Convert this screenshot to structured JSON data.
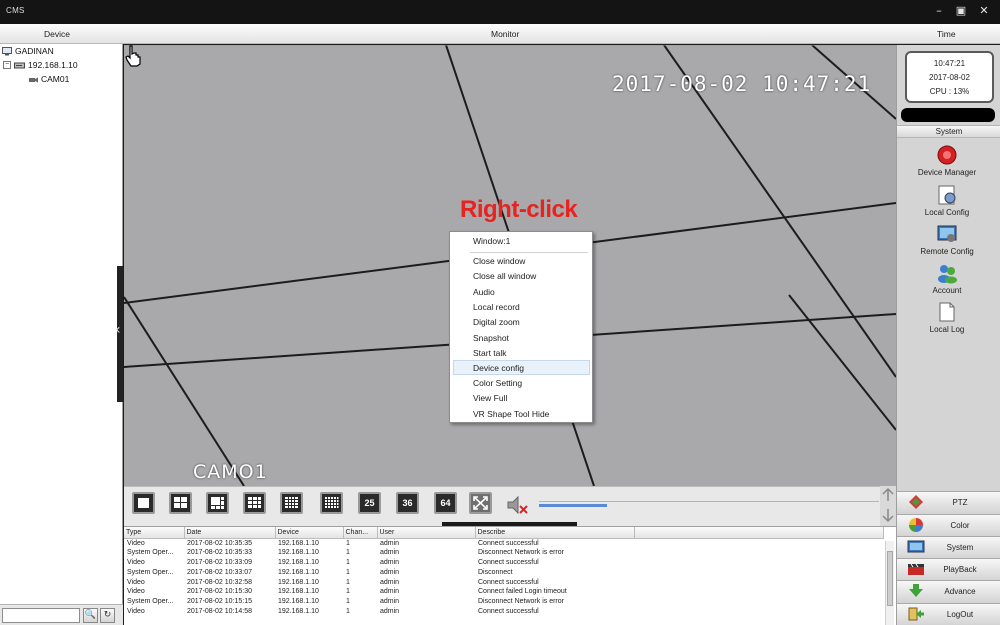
{
  "window": {
    "title": "CMS",
    "minimize": "–",
    "restore": "▣",
    "close": "✕"
  },
  "header": {
    "device": "Device",
    "monitor": "Monitor",
    "time": "Time"
  },
  "tree": {
    "root": "GADINAN",
    "device": "192.168.1.10",
    "channel": "CAM01",
    "expand_symbol": "−"
  },
  "search": {
    "value": "",
    "search_icon": "magnifier-icon",
    "refresh_icon": "refresh-icon"
  },
  "video": {
    "timestamp": "2017-08-02 10:47:21",
    "camera_label": "CAMO1",
    "annotation": "Right-click"
  },
  "context_menu": {
    "header": "Window:1",
    "items": [
      "Close window",
      "Close all window",
      "Audio",
      "Local record",
      "Digital zoom",
      "Snapshot",
      "Start talk",
      "Device config",
      "Color Setting",
      "View Full",
      "VR Shape Tool Hide"
    ],
    "highlighted": "Device config"
  },
  "layout_toolbar": {
    "buttons": [
      "1",
      "4",
      "6",
      "9",
      "16",
      "16b",
      "25",
      "36",
      "64",
      "fullscreen",
      "mute"
    ],
    "labels": {
      "b25": "25",
      "b36": "36",
      "b64": "64"
    },
    "volume": 0.2
  },
  "log": {
    "columns": [
      "Type",
      "Date",
      "Device",
      "Chan...",
      "User",
      "Describe"
    ],
    "rows": [
      [
        "Video",
        "2017-08-02 10:35:35",
        "192.168.1.10",
        "1",
        "admin",
        "Connect successful"
      ],
      [
        "System Oper...",
        "2017-08-02 10:35:33",
        "192.168.1.10",
        "1",
        "admin",
        "Disconnect Network is error"
      ],
      [
        "Video",
        "2017-08-02 10:33:09",
        "192.168.1.10",
        "1",
        "admin",
        "Connect successful"
      ],
      [
        "System Oper...",
        "2017-08-02 10:33:07",
        "192.168.1.10",
        "1",
        "admin",
        "Disconnect"
      ],
      [
        "Video",
        "2017-08-02 10:32:58",
        "192.168.1.10",
        "1",
        "admin",
        "Connect successful"
      ],
      [
        "Video",
        "2017-08-02 10:15:30",
        "192.168.1.10",
        "1",
        "admin",
        "Connect failed Login timeout"
      ],
      [
        "System Oper...",
        "2017-08-02 10:15:15",
        "192.168.1.10",
        "1",
        "admin",
        "Disconnect Network is error"
      ],
      [
        "Video",
        "2017-08-02 10:14:58",
        "192.168.1.10",
        "1",
        "admin",
        "Connect successful"
      ]
    ]
  },
  "clock": {
    "time": "10:47:21",
    "date": "2017-08-02",
    "cpu": "CPU : 13%"
  },
  "system": {
    "title": "System",
    "items": [
      "Device Manager",
      "Local Config",
      "Remote Config",
      "Account",
      "Local Log"
    ]
  },
  "bottom_buttons": [
    "PTZ",
    "Color",
    "System",
    "PlayBack",
    "Advance",
    "LogOut"
  ],
  "colors": {
    "annotation": "#e8231f",
    "volume": "#5b8bd6",
    "highlight": "#e9f1fb"
  }
}
